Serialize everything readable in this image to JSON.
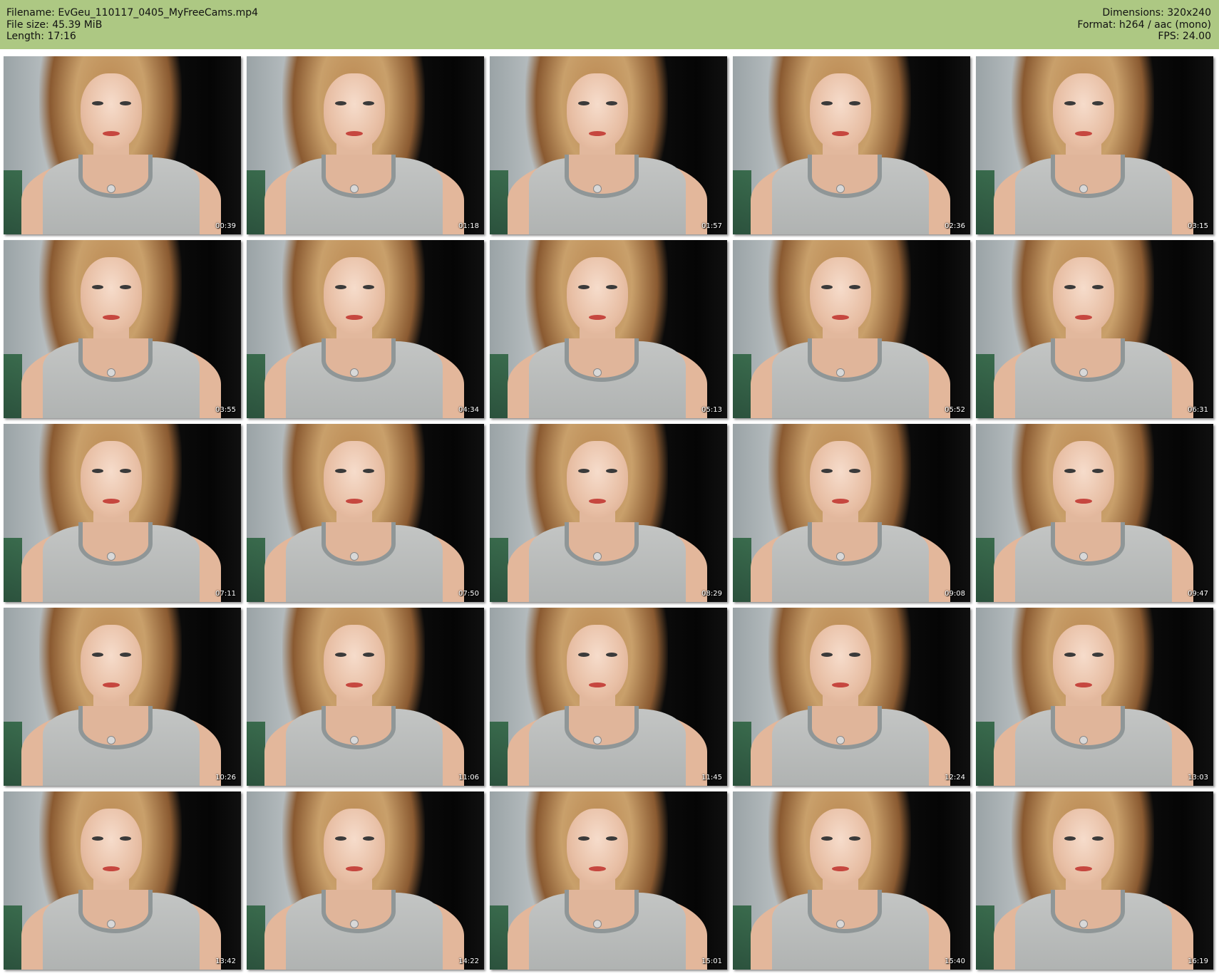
{
  "header": {
    "filename_label": "Filename:",
    "filename": "EvGeu_110117_0405_MyFreeCams.mp4",
    "filesize_label": "File size:",
    "filesize": "45.39 MiB",
    "length_label": "Length:",
    "length": "17:16",
    "dimensions_label": "Dimensions:",
    "dimensions": "320x240",
    "format_label": "Format:",
    "format": "h264 / aac (mono)",
    "fps_label": "FPS:",
    "fps": "24.00"
  },
  "colors": {
    "header_bg": "#adc883",
    "page_bg": "#ffffff"
  },
  "thumbnails": [
    {
      "time": "00:39"
    },
    {
      "time": "01:18"
    },
    {
      "time": "01:57"
    },
    {
      "time": "02:36"
    },
    {
      "time": "03:15"
    },
    {
      "time": "03:55"
    },
    {
      "time": "04:34"
    },
    {
      "time": "05:13"
    },
    {
      "time": "05:52"
    },
    {
      "time": "06:31"
    },
    {
      "time": "07:11"
    },
    {
      "time": "07:50"
    },
    {
      "time": "08:29"
    },
    {
      "time": "09:08"
    },
    {
      "time": "09:47"
    },
    {
      "time": "10:26"
    },
    {
      "time": "11:06"
    },
    {
      "time": "11:45"
    },
    {
      "time": "12:24"
    },
    {
      "time": "13:03"
    },
    {
      "time": "13:42"
    },
    {
      "time": "14:22"
    },
    {
      "time": "15:01"
    },
    {
      "time": "15:40"
    },
    {
      "time": "16:19"
    }
  ]
}
